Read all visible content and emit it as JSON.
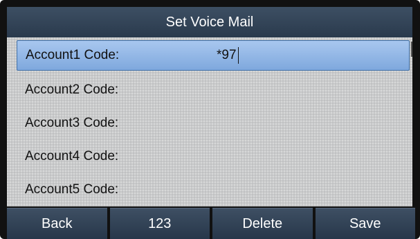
{
  "screen": {
    "title": "Set Voice Mail"
  },
  "accounts": [
    {
      "label": "Account1 Code:",
      "value": "*97"
    },
    {
      "label": "Account2 Code:",
      "value": ""
    },
    {
      "label": "Account3 Code:",
      "value": ""
    },
    {
      "label": "Account4 Code:",
      "value": ""
    },
    {
      "label": "Account5 Code:",
      "value": ""
    }
  ],
  "softkeys": {
    "back": "Back",
    "input_mode": "123",
    "delete": "Delete",
    "save": "Save"
  },
  "colors": {
    "title_bar": "#2f4054",
    "selected_row": "#93b8e6",
    "softkey": "#33445a"
  }
}
